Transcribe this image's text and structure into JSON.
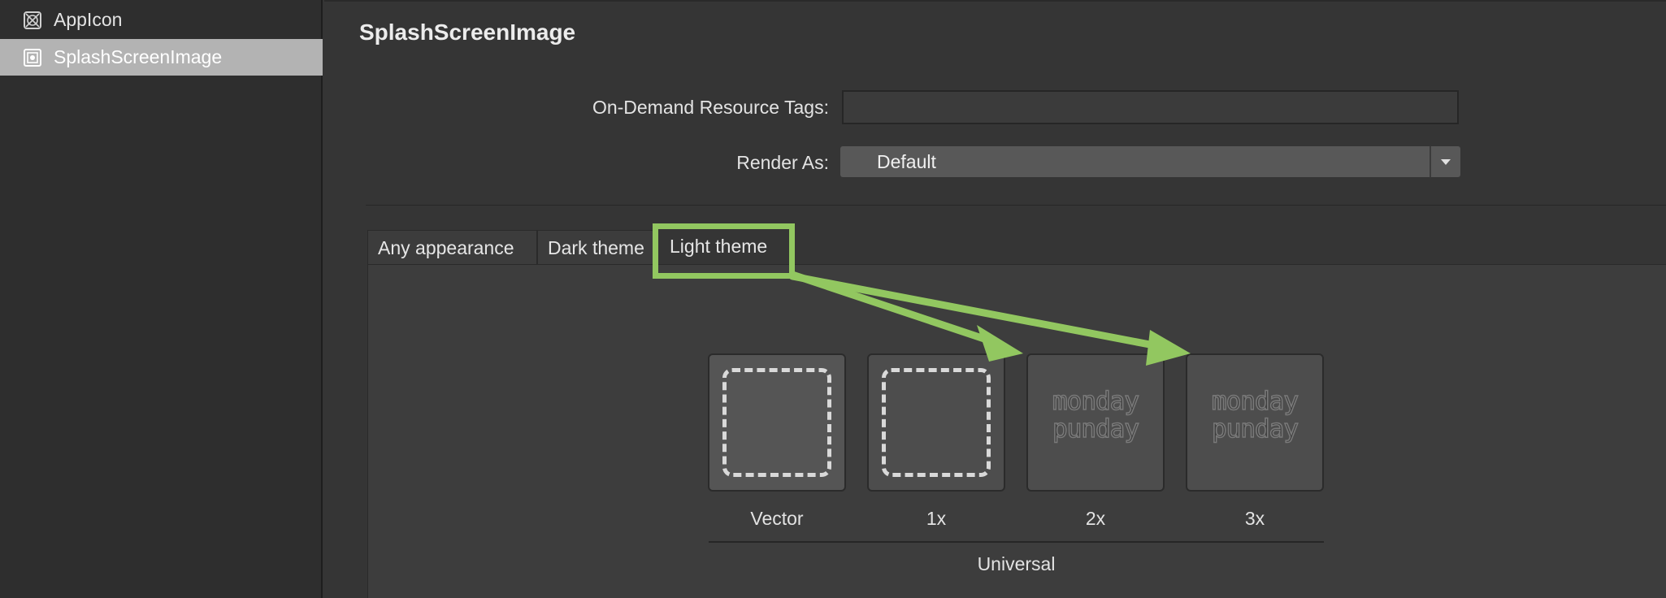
{
  "sidebar": {
    "items": [
      {
        "label": "AppIcon",
        "icon": "appicon-icon"
      },
      {
        "label": "SplashScreenImage",
        "icon": "image-set-icon",
        "selected": true
      }
    ]
  },
  "main": {
    "title": "SplashScreenImage",
    "on_demand_label": "On-Demand Resource Tags:",
    "on_demand_value": "",
    "render_as_label": "Render As:",
    "render_as_value": "Default",
    "tabs": [
      {
        "label": "Any appearance"
      },
      {
        "label": "Dark theme"
      },
      {
        "label": "Light theme",
        "highlighted": true
      }
    ],
    "slots": [
      {
        "label": "Vector",
        "state": "empty"
      },
      {
        "label": "1x",
        "state": "empty"
      },
      {
        "label": "2x",
        "state": "image",
        "image_text": [
          "monday",
          "punday"
        ]
      },
      {
        "label": "3x",
        "state": "image",
        "image_text": [
          "monday",
          "punday"
        ]
      }
    ],
    "group_label": "Universal"
  },
  "colors": {
    "accent": "#92c760",
    "background": "#353535",
    "sidebar_selected": "#b3b3b3"
  }
}
